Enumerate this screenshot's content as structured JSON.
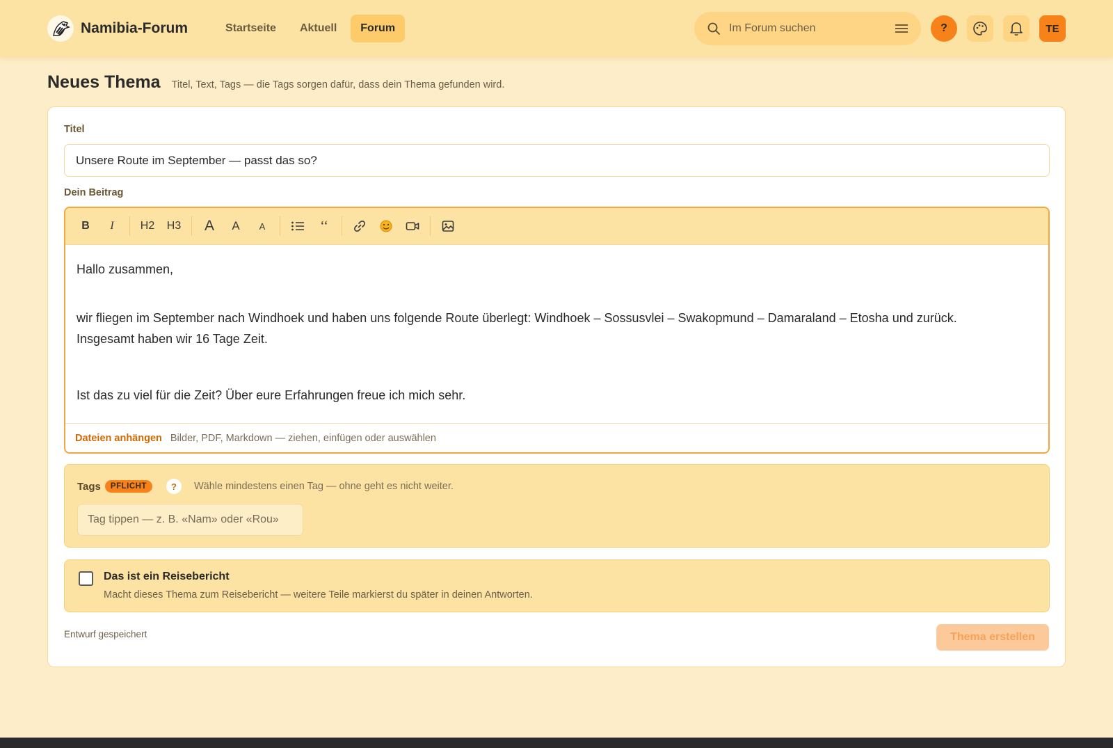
{
  "header": {
    "brand": "Namibia-Forum",
    "nav": [
      "Startseite",
      "Aktuell",
      "Forum"
    ],
    "active_nav": "Forum",
    "search_placeholder": "Im Forum suchen",
    "help_label": "?",
    "avatar_initials": "TE"
  },
  "page": {
    "title": "Neues Thema",
    "subtitle": "Titel, Text, Tags — die Tags sorgen dafür, dass dein Thema gefunden wird."
  },
  "form": {
    "title_label": "Titel",
    "title_value": "Unsere Route im September — passt das so?",
    "body_label": "Dein Beitrag",
    "toolbar": {
      "bold": "B",
      "italic": "I",
      "h2": "H2",
      "h3": "H3",
      "font_large": "A",
      "font_medium": "A",
      "font_small": "A",
      "quote": "‘‘"
    },
    "body": {
      "line1": "Hallo zusammen,",
      "line2": "wir fliegen im September nach Windhoek und haben uns folgende Route überlegt: Windhoek – Sossusvlei – Swakopmund – Damaraland – Etosha und zurück.",
      "line3": "Insgesamt haben wir 16 Tage Zeit.",
      "line4": "Ist das zu viel für die Zeit? Über eure Erfahrungen freue ich mich sehr."
    },
    "attach_link": "Dateien anhängen",
    "attach_hint": "Bilder, PDF, Markdown — ziehen, einfügen oder auswählen",
    "tags": {
      "label": "Tags",
      "badge": "PFLICHT",
      "help": "?",
      "hint": "Wähle mindestens einen Tag — ohne geht es nicht weiter.",
      "placeholder": "Tag tippen — z. B. «Nam» oder «Rou»"
    },
    "report": {
      "title": "Das ist ein Reisebericht",
      "description": "Macht dieses Thema zum Reisebericht — weitere Teile markierst du später in deinen Antworten."
    },
    "draft_status": "Entwurf gespeichert",
    "submit_label": "Thema erstellen"
  },
  "colors": {
    "accent": "#f8821a",
    "header_bg": "#fde3a3",
    "page_bg": "#fdedc8",
    "link": "#d16a05"
  },
  "icons": [
    "zebra-logo-icon",
    "search-icon",
    "menu-lines-icon",
    "help-icon",
    "palette-icon",
    "bell-icon",
    "list-icon",
    "quote-icon",
    "link-icon",
    "emoji-icon",
    "video-icon",
    "image-icon"
  ]
}
